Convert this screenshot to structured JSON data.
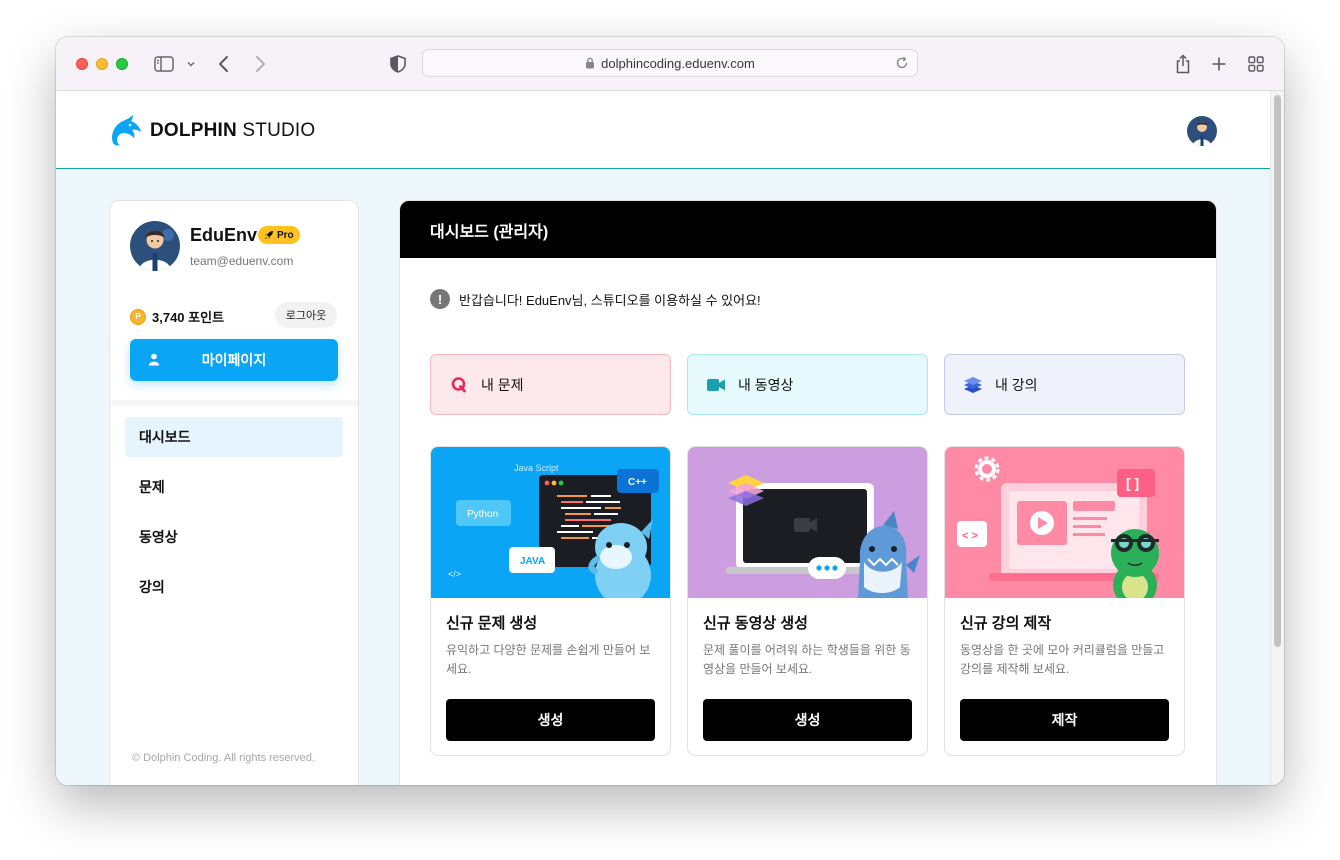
{
  "browser": {
    "url": "dolphincoding.eduenv.com"
  },
  "header": {
    "logo_bold": "DOLPHIN",
    "logo_light": " STUDIO"
  },
  "profile": {
    "name": "EduEnv",
    "badge": "Pro",
    "email": "team@eduenv.com",
    "points": "3,740 포인트",
    "coin_symbol": "P",
    "logout_label": "로그아웃",
    "mypage_label": "마이페이지"
  },
  "sidebar": {
    "items": [
      {
        "label": "대시보드",
        "active": true
      },
      {
        "label": "문제",
        "active": false
      },
      {
        "label": "동영상",
        "active": false
      },
      {
        "label": "강의",
        "active": false
      }
    ],
    "footer": "© Dolphin Coding. All rights reserved."
  },
  "main": {
    "title": "대시보드 (관리자)",
    "notice": "반갑습니다! EduEnv님, 스튜디오를 이용하실 수 있어요!",
    "quick_links": [
      {
        "label": "내 문제",
        "icon": "q-icon",
        "color": "#e8265e"
      },
      {
        "label": "내 동영상",
        "icon": "video-camera-icon",
        "color": "#1aa1ad"
      },
      {
        "label": "내 강의",
        "icon": "layers-icon",
        "color": "#3d63dd"
      }
    ],
    "cards": [
      {
        "title": "신규 문제 생성",
        "description": "유익하고 다양한 문제를 손쉽게 만들어 보세요.",
        "button": "생성",
        "bg": "#0aa5f5",
        "art_labels": [
          "Java Script",
          "C++",
          "Python",
          "JAVA",
          "</>"
        ]
      },
      {
        "title": "신규 동영상 생성",
        "description": "문제 풀이를 어려워 하는 학생들을 위한 동영상을 만들어 보세요.",
        "button": "생성",
        "bg": "#cc9ee0",
        "art_labels": []
      },
      {
        "title": "신규 강의 제작",
        "description": "동영상을 한 곳에 모아 커리큘럼을 만들고 강의를 제작해 보세요.",
        "button": "제작",
        "bg": "#ff8aa6",
        "art_labels": [
          "[ ]",
          "< >"
        ]
      }
    ]
  },
  "colors": {
    "accent": "#0aa5f5",
    "header_line": "#12a3a9",
    "page_bg": "#eef8fc",
    "badge": "#ffc21f"
  }
}
